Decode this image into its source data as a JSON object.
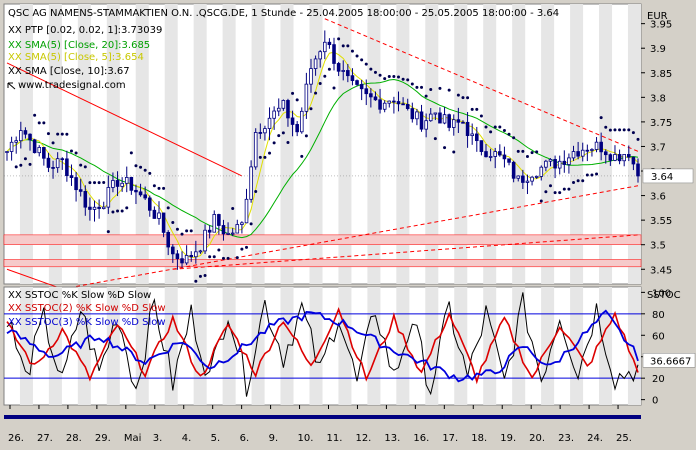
{
  "header": {
    "title": "QSC AG NAMENS-STAMMAKTIEN O.N. .QSCG.DE, 1 Stunde - 25.04.2005 18:00:00 - 25.05.2005 18:00:00 - 3.64",
    "indicators": [
      {
        "text": "XX PTP [0.02, 0.02, 1]:3.73039",
        "color": "#000000"
      },
      {
        "text": "XX SMA(5) [Close, 20]:3.685",
        "color": "#00a000"
      },
      {
        "text": "XX SMA(5) [Close, 5]:3.654",
        "color": "#c8c800"
      },
      {
        "text": "XX SMA [Close, 10]:3.67",
        "color": "#000000"
      }
    ],
    "source": "www.tradesignal.com"
  },
  "lower_header": {
    "indicators": [
      {
        "text": "XX SSTOC %K Slow %D Slow",
        "color": "#000000"
      },
      {
        "text": "XX SSTOC(2) %K Slow %D Slow",
        "color": "#d00000"
      },
      {
        "text": "XX SSTOC(3) %K Slow %D Slow",
        "color": "#0000d0"
      }
    ]
  },
  "axes": {
    "price_unit": "EUR",
    "osc_unit": "SSTOC",
    "last_price_label": "3.64",
    "last_osc_label": "36.6667"
  },
  "colors": {
    "background": "#ffffff",
    "frame": "#d4d0c8",
    "candle": "#000080",
    "sar": "#000050",
    "sma20": "#00b000",
    "sma5": "#e0e000",
    "trend": "#ff0000",
    "band": "#f6caca",
    "stoch1": "#000000",
    "stoch2": "#dd0000",
    "stoch3": "#0000dd",
    "shade": "#e6e6e6"
  },
  "chart_data": [
    {
      "type": "candlestick",
      "title": "QSC AG NAMENS-STAMMAKTIEN O.N. .QSCG.DE, 1 Stunde",
      "ylabel": "EUR",
      "ylim": [
        3.42,
        3.99
      ],
      "yticks": [
        3.45,
        3.5,
        3.55,
        3.6,
        3.65,
        3.7,
        3.75,
        3.8,
        3.85,
        3.9,
        3.95
      ],
      "x_labels": [
        "26.",
        "27.",
        "28.",
        "29.",
        "Mai",
        "3.",
        "4.",
        "5.",
        "6.",
        "9.",
        "10.",
        "11.",
        "12.",
        "13.",
        "16.",
        "17.",
        "18.",
        "19.",
        "20.",
        "23.",
        "24.",
        "25."
      ],
      "last_value": 3.64,
      "price_path": [
        [
          0,
          3.69
        ],
        [
          3,
          3.74
        ],
        [
          6,
          3.7
        ],
        [
          9,
          3.66
        ],
        [
          12,
          3.67
        ],
        [
          15,
          3.62
        ],
        [
          18,
          3.57
        ],
        [
          21,
          3.59
        ],
        [
          24,
          3.63
        ],
        [
          27,
          3.62
        ],
        [
          30,
          3.59
        ],
        [
          33,
          3.55
        ],
        [
          36,
          3.48
        ],
        [
          39,
          3.47
        ],
        [
          42,
          3.5
        ],
        [
          45,
          3.55
        ],
        [
          48,
          3.52
        ],
        [
          51,
          3.54
        ],
        [
          54,
          3.73
        ],
        [
          57,
          3.76
        ],
        [
          60,
          3.78
        ],
        [
          63,
          3.73
        ],
        [
          66,
          3.86
        ],
        [
          69,
          3.92
        ],
        [
          72,
          3.86
        ],
        [
          75,
          3.82
        ],
        [
          78,
          3.8
        ],
        [
          81,
          3.79
        ],
        [
          84,
          3.8
        ],
        [
          87,
          3.77
        ],
        [
          90,
          3.75
        ],
        [
          93,
          3.77
        ],
        [
          96,
          3.74
        ],
        [
          99,
          3.75
        ],
        [
          102,
          3.7
        ],
        [
          105,
          3.69
        ],
        [
          108,
          3.67
        ],
        [
          111,
          3.63
        ],
        [
          114,
          3.65
        ],
        [
          117,
          3.66
        ],
        [
          120,
          3.67
        ],
        [
          123,
          3.69
        ],
        [
          126,
          3.7
        ],
        [
          129,
          3.7
        ],
        [
          132,
          3.68
        ],
        [
          135,
          3.69
        ],
        [
          137,
          3.64
        ]
      ],
      "series": [
        {
          "name": "XX PTP [0.02, 0.02, 1]",
          "last": 3.73039
        },
        {
          "name": "XX SMA(5) [Close, 20]",
          "last": 3.685
        },
        {
          "name": "XX SMA(5) [Close, 5]",
          "last": 3.654
        },
        {
          "name": "XX SMA [Close, 10]",
          "last": 3.67
        }
      ],
      "trendlines": [
        {
          "from": [
            0,
            3.87
          ],
          "to": [
            51,
            3.64
          ]
        },
        {
          "from": [
            0,
            3.45
          ],
          "to": [
            12,
            3.41
          ]
        },
        {
          "from": [
            12,
            3.41
          ],
          "to": [
            137,
            3.62
          ]
        },
        {
          "from": [
            36,
            3.45
          ],
          "to": [
            137,
            3.52
          ]
        },
        {
          "from": [
            69,
            3.96
          ],
          "to": [
            137,
            3.69
          ]
        }
      ],
      "bands": [
        {
          "from": 3.5,
          "to": 3.52
        },
        {
          "from": 3.455,
          "to": 3.47
        }
      ]
    },
    {
      "type": "line",
      "title": "XX SSTOC %K Slow %D Slow",
      "ylabel": "SSTOC",
      "ylim": [
        -5,
        105
      ],
      "yticks": [
        0,
        20,
        40,
        60,
        80,
        100
      ],
      "reference_lines": [
        20,
        80
      ],
      "last_value": 36.6667,
      "series": [
        {
          "name": "XX SSTOC %K Slow %D Slow",
          "path": [
            [
              0,
              80
            ],
            [
              4,
              20
            ],
            [
              8,
              75
            ],
            [
              12,
              15
            ],
            [
              16,
              85
            ],
            [
              20,
              25
            ],
            [
              24,
              80
            ],
            [
              28,
              10
            ],
            [
              32,
              90
            ],
            [
              36,
              15
            ],
            [
              40,
              80
            ],
            [
              44,
              20
            ],
            [
              48,
              85
            ],
            [
              52,
              15
            ],
            [
              56,
              90
            ],
            [
              60,
              40
            ],
            [
              64,
              85
            ],
            [
              68,
              25
            ],
            [
              72,
              80
            ],
            [
              76,
              15
            ],
            [
              80,
              85
            ],
            [
              84,
              20
            ],
            [
              88,
              75
            ],
            [
              92,
              10
            ],
            [
              96,
              85
            ],
            [
              100,
              20
            ],
            [
              104,
              80
            ],
            [
              108,
              15
            ],
            [
              112,
              90
            ],
            [
              116,
              20
            ],
            [
              120,
              80
            ],
            [
              124,
              25
            ],
            [
              128,
              85
            ],
            [
              132,
              20
            ],
            [
              137,
              30
            ]
          ]
        },
        {
          "name": "XX SSTOC(2) %K Slow %D Slow",
          "path": [
            [
              0,
              70
            ],
            [
              6,
              30
            ],
            [
              12,
              65
            ],
            [
              18,
              20
            ],
            [
              24,
              70
            ],
            [
              30,
              25
            ],
            [
              36,
              75
            ],
            [
              42,
              20
            ],
            [
              48,
              70
            ],
            [
              54,
              25
            ],
            [
              60,
              75
            ],
            [
              66,
              30
            ],
            [
              72,
              85
            ],
            [
              78,
              20
            ],
            [
              84,
              75
            ],
            [
              90,
              25
            ],
            [
              96,
              80
            ],
            [
              102,
              20
            ],
            [
              108,
              75
            ],
            [
              114,
              20
            ],
            [
              120,
              70
            ],
            [
              126,
              30
            ],
            [
              132,
              80
            ],
            [
              137,
              25
            ]
          ]
        },
        {
          "name": "XX SSTOC(3) %K Slow %D Slow",
          "path": [
            [
              0,
              65
            ],
            [
              10,
              40
            ],
            [
              20,
              60
            ],
            [
              30,
              35
            ],
            [
              38,
              55
            ],
            [
              44,
              30
            ],
            [
              50,
              45
            ],
            [
              58,
              70
            ],
            [
              66,
              80
            ],
            [
              74,
              70
            ],
            [
              82,
              50
            ],
            [
              90,
              35
            ],
            [
              98,
              20
            ],
            [
              106,
              25
            ],
            [
              112,
              50
            ],
            [
              118,
              30
            ],
            [
              124,
              55
            ],
            [
              130,
              80
            ],
            [
              137,
              40
            ]
          ]
        }
      ]
    }
  ]
}
